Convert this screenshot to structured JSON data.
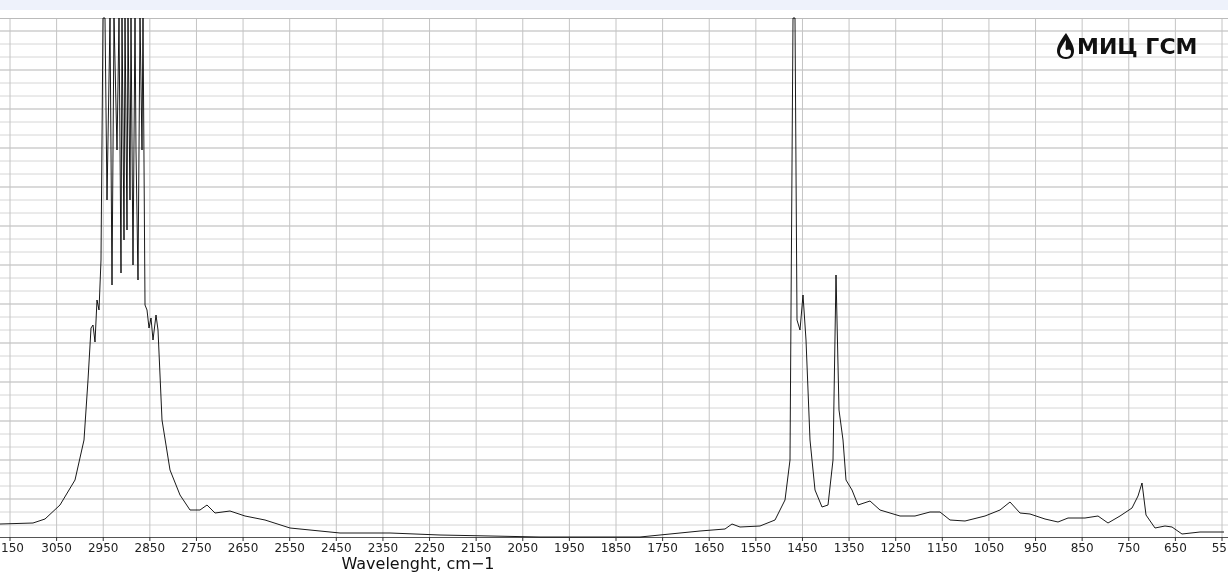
{
  "chart": {
    "logo": "МИЦ ГСМ",
    "xlabel": "Wavelenght, cm−1",
    "xticks": [
      "150",
      "3050",
      "2950",
      "2850",
      "2750",
      "2650",
      "2550",
      "2450",
      "2350",
      "2250",
      "2150",
      "2050",
      "1950",
      "1850",
      "1750",
      "1650",
      "1550",
      "1450",
      "1350",
      "1250",
      "1150",
      "1050",
      "950",
      "850",
      "750",
      "650",
      "55"
    ]
  }
}
